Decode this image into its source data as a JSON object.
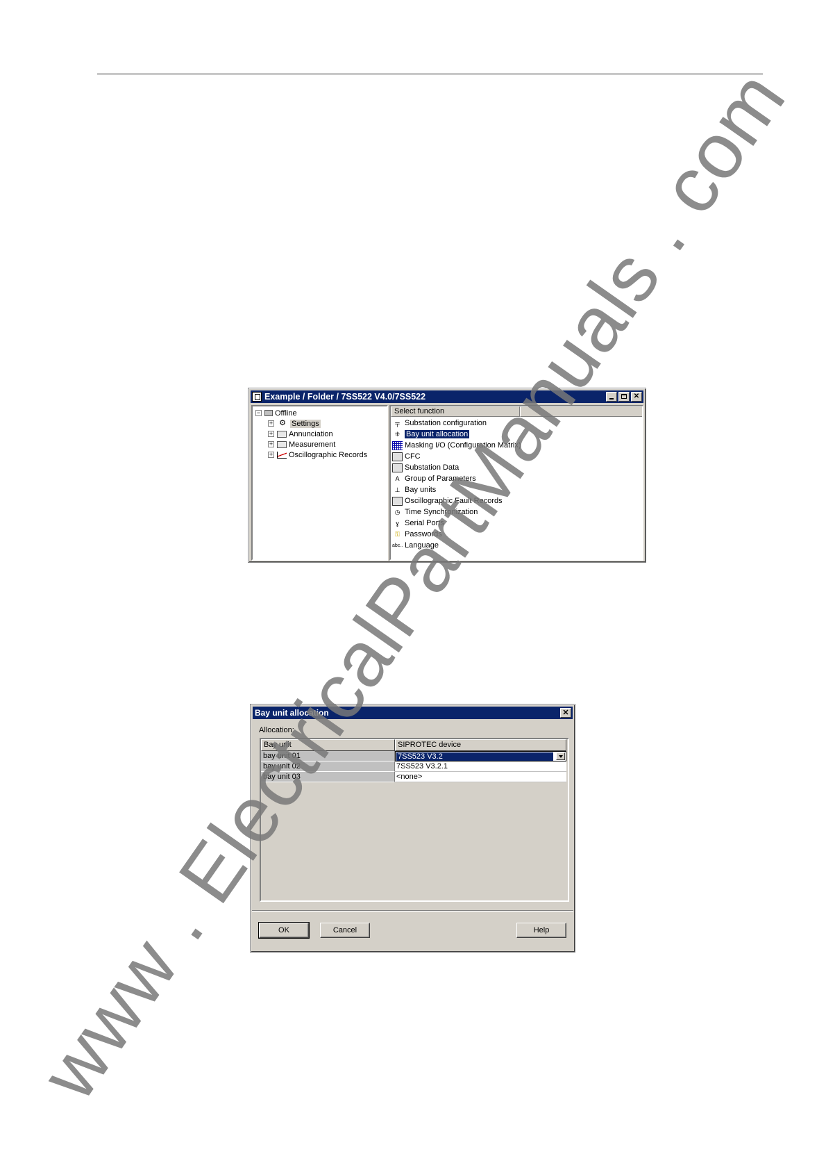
{
  "window1": {
    "title": "Example / Folder / 7SS522 V4.0/7SS522",
    "tree": {
      "root": "Offline",
      "children": [
        "Settings",
        "Annunciation",
        "Measurement",
        "Oscillographic Records"
      ]
    },
    "list_header": "Select function",
    "functions": [
      "Substation configuration",
      "Bay unit allocation",
      "Masking I/O (Configuration Matrix)",
      "CFC",
      "Substation Data",
      "Group of Parameters",
      "Bay units",
      "Oscillographic Fault Records",
      "Time Synchronization",
      "Serial Ports",
      "Passwords",
      "Language"
    ],
    "selected_function": "Bay unit allocation"
  },
  "dialog": {
    "title": "Bay unit allocation",
    "group_label": "Allocation:",
    "columns": [
      "Bay unit",
      "SIPROTEC device"
    ],
    "rows": [
      {
        "bay_unit": "bay unit 01",
        "device": "7SS523 V3.2"
      },
      {
        "bay_unit": "bay unit 02",
        "device": "7SS523 V3.2.1"
      },
      {
        "bay_unit": "bay unit 03",
        "device": "<none>"
      }
    ],
    "buttons": {
      "ok": "OK",
      "cancel": "Cancel",
      "help": "Help"
    }
  },
  "watermark": "www . ElectricalPartManuals . com",
  "colors": {
    "titlebar": "#0a246a",
    "face": "#d4d0c8",
    "selection": "#0a246a"
  }
}
